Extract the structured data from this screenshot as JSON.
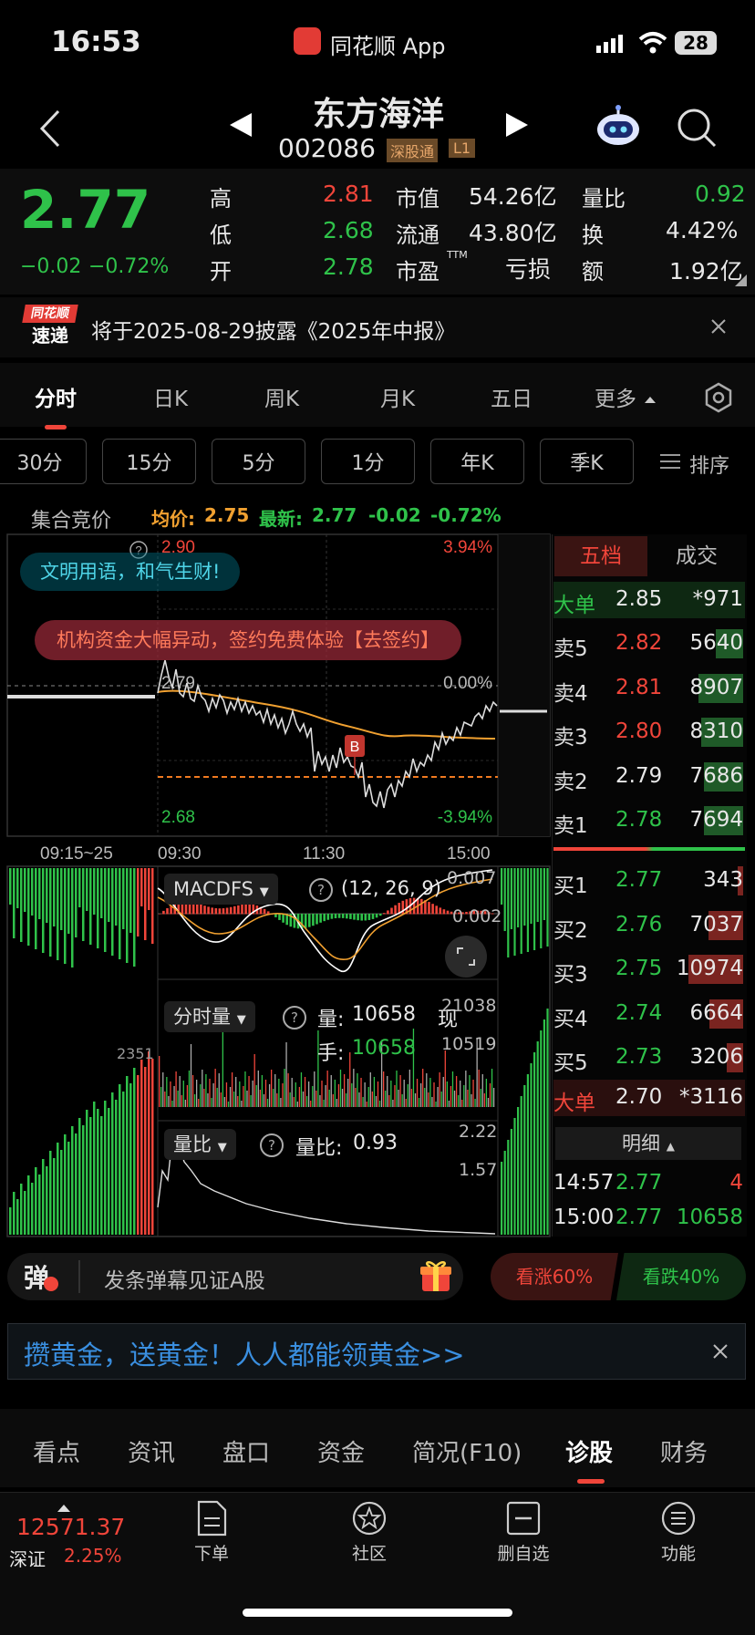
{
  "status_bar": {
    "time": "16:53",
    "app_name": "同花顺 App",
    "battery": "28"
  },
  "header": {
    "name": "东方海洋",
    "code": "002086",
    "tag1": "深股通",
    "tag2": "L1"
  },
  "quote": {
    "price": "2.77",
    "change": "−0.02",
    "change_pct": "−0.72%",
    "high_label": "高",
    "high": "2.81",
    "low_label": "低",
    "low": "2.68",
    "open_label": "开",
    "open": "2.78",
    "mktcap_label": "市值",
    "mktcap": "54.26亿",
    "float_label": "流通",
    "float": "43.80亿",
    "pe_label": "市盈",
    "pe_sup": "TTM",
    "pe": "亏损",
    "vr_label": "量比",
    "vr": "0.92",
    "turn_label": "换",
    "turn": "4.42%",
    "amt_label": "额",
    "amt": "1.92亿"
  },
  "news": {
    "logo_top": "同花顺",
    "logo_bottom": "速递",
    "text": "将于2025-08-29披露《2025年中报》"
  },
  "tabs": [
    "分时",
    "日K",
    "周K",
    "月K",
    "五日",
    "更多"
  ],
  "chips": [
    "30分",
    "15分",
    "5分",
    "1分",
    "年K",
    "季K"
  ],
  "sort_label": "排序",
  "chart_info": {
    "auction_label": "集合竞价",
    "avg_label": "均价:",
    "avg": "2.75",
    "latest_label": "最新:",
    "latest": "2.77",
    "latest_chg": "-0.02",
    "latest_pct": "-0.72%",
    "top_price": "2.90",
    "top_pct": "3.94%",
    "mid_price": "2.79",
    "mid_pct": "0.00%",
    "bottom_price": "2.68",
    "bottom_pct": "-3.94%",
    "time_0": "09:15~25",
    "time_1": "09:30",
    "time_2": "11:30",
    "time_3": "15:00",
    "banner1": "文明用语，和气生财!",
    "banner2": "机构资金大幅异动，签约免费体验【去签约】",
    "b_marker": "B"
  },
  "macd": {
    "name": "MACDFS",
    "params": "(12, 26, 9)",
    "v1": "0.007",
    "v2": "0.002"
  },
  "volume_panel": {
    "name": "分时量",
    "vol_label": "量:",
    "vol": "10658",
    "now_label": "现",
    "hand_label": "手:",
    "hand": "10658",
    "max": "21038",
    "mid": "10519",
    "left_mark": "2351"
  },
  "vr_panel": {
    "name": "量比",
    "vr_label": "量比:",
    "vr": "0.93",
    "max": "2.22",
    "mid": "1.57"
  },
  "orderbook": {
    "tab_active": "五档",
    "tab_other": "成交",
    "big_sell": {
      "label": "大单",
      "price": "2.85",
      "vol": "*971"
    },
    "asks": [
      {
        "label": "卖5",
        "price": "2.82",
        "vol": "5640",
        "bar": 0.5
      },
      {
        "label": "卖4",
        "price": "2.81",
        "vol": "8907",
        "bar": 0.82
      },
      {
        "label": "卖3",
        "price": "2.80",
        "vol": "8310",
        "bar": 0.77
      },
      {
        "label": "卖2",
        "price": "2.79",
        "vol": "7686",
        "bar": 0.71
      },
      {
        "label": "卖1",
        "price": "2.78",
        "vol": "7694",
        "bar": 0.71
      }
    ],
    "bids": [
      {
        "label": "买1",
        "price": "2.77",
        "vol": "343",
        "bar": 0.03
      },
      {
        "label": "买2",
        "price": "2.76",
        "vol": "7037",
        "bar": 0.64
      },
      {
        "label": "买3",
        "price": "2.75",
        "vol": "10974",
        "bar": 1.0
      },
      {
        "label": "买4",
        "price": "2.74",
        "vol": "6664",
        "bar": 0.61
      },
      {
        "label": "买5",
        "price": "2.73",
        "vol": "3206",
        "bar": 0.3
      }
    ],
    "big_buy": {
      "label": "大单",
      "price": "2.70",
      "vol": "*3116"
    },
    "detail_label": "明细",
    "trades": [
      {
        "time": "14:57",
        "price": "2.77",
        "vol": "4"
      },
      {
        "time": "15:00",
        "price": "2.77",
        "vol": "10658"
      }
    ]
  },
  "barrage": {
    "icon": "弹",
    "placeholder": "发条弹幕见证A股",
    "up": "看涨60%",
    "down": "看跌40%"
  },
  "promo": {
    "text": "攒黄金，送黄金！人人都能领黄金>>"
  },
  "bottom_tabs": [
    "看点",
    "资讯",
    "盘口",
    "资金",
    "简况(F10)",
    "诊股",
    "财务"
  ],
  "bottom_tab_active": "诊股",
  "index": {
    "value": "12571.37",
    "name": "深证",
    "pct": "2.25%"
  },
  "nav": [
    "下单",
    "社区",
    "删自选",
    "功能"
  ],
  "colors": {
    "up": "#f0453a",
    "down": "#2fc24a",
    "avg": "#f0a030",
    "bg": "#000000"
  }
}
